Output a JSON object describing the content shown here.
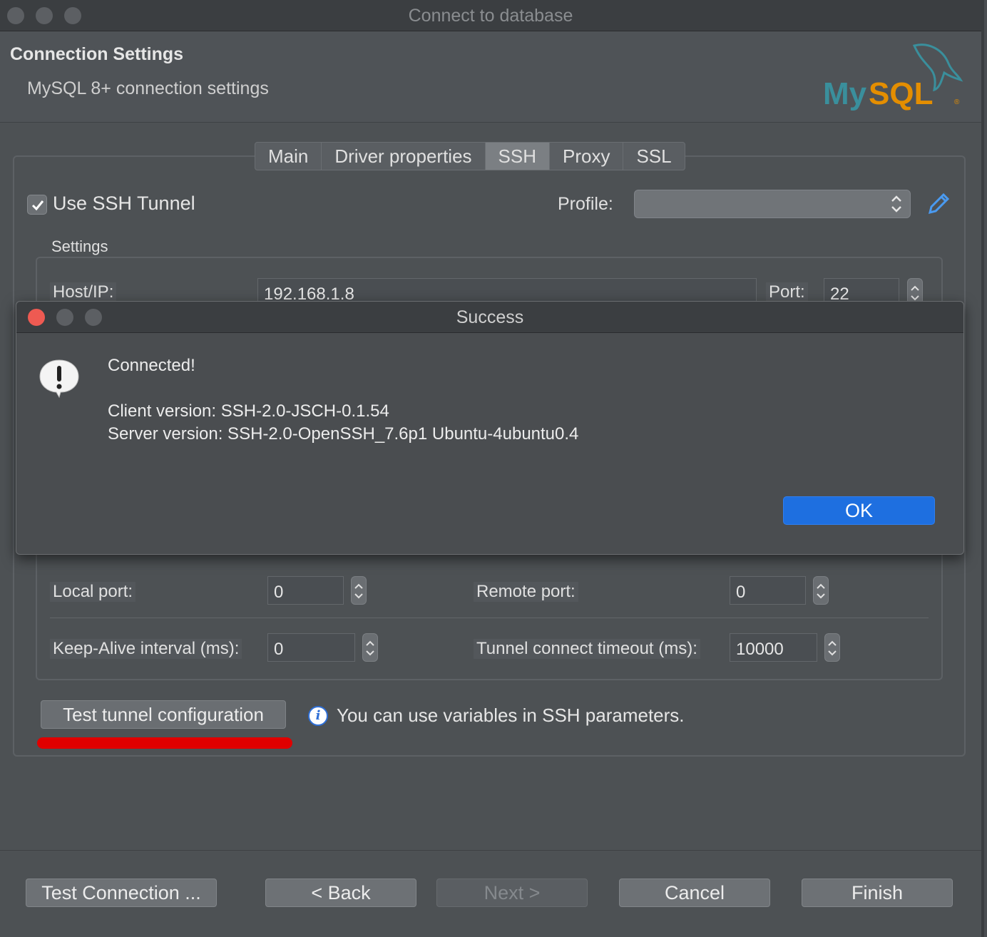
{
  "window": {
    "title": "Connect to database"
  },
  "header": {
    "title": "Connection Settings",
    "subtitle": "MySQL 8+ connection settings",
    "logo_text": "MySQL"
  },
  "tabs": [
    "Main",
    "Driver properties",
    "SSH",
    "Proxy",
    "SSL"
  ],
  "active_tab": "SSH",
  "ssh": {
    "use_tunnel_label": "Use SSH Tunnel",
    "use_tunnel_checked": true,
    "profile_label": "Profile:",
    "profile_value": "",
    "settings_label": "Settings",
    "host_label": "Host/IP:",
    "host_value": "192.168.1.8",
    "port_label": "Port:",
    "port_value": "22",
    "local_port_label": "Local port:",
    "local_port_value": "0",
    "remote_port_label": "Remote port:",
    "remote_port_value": "0",
    "keepalive_label": "Keep-Alive interval (ms):",
    "keepalive_value": "0",
    "timeout_label": "Tunnel connect timeout (ms):",
    "timeout_value": "10000",
    "test_button": "Test tunnel configuration",
    "info_text": "You can use variables in SSH parameters."
  },
  "footer": {
    "test_connection": "Test Connection ...",
    "back": "< Back",
    "next": "Next >",
    "cancel": "Cancel",
    "finish": "Finish"
  },
  "dialog": {
    "title": "Success",
    "line1": "Connected!",
    "line2": "Client version: SSH-2.0-JSCH-0.1.54",
    "line3": "Server version: SSH-2.0-OpenSSH_7.6p1 Ubuntu-4ubuntu0.4",
    "ok": "OK"
  },
  "colors": {
    "accent": "#1e6fe0",
    "highlight": "#e00000",
    "mysql_teal": "#3a8f9c",
    "mysql_orange": "#e48e00"
  }
}
